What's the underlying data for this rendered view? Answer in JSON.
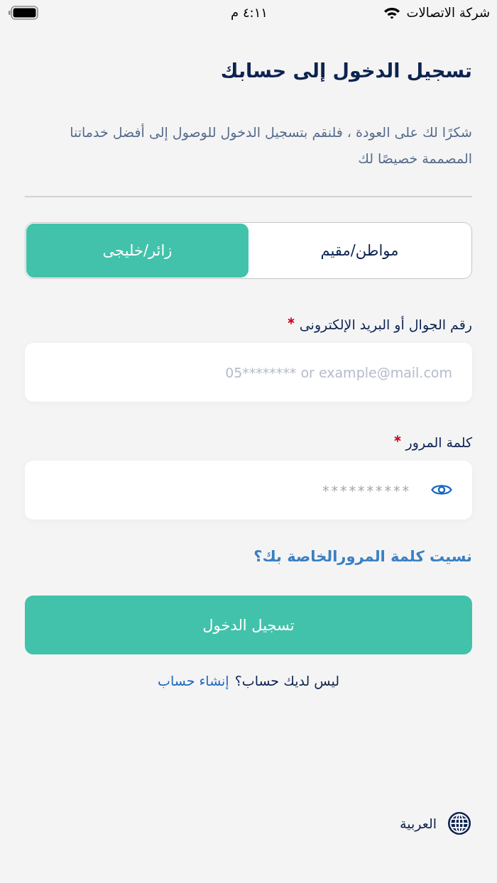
{
  "status_bar": {
    "carrier": "شركة الاتصالات",
    "time": "٤:١١ م"
  },
  "header": {
    "title": "تسجيل الدخول إلى حسابك",
    "subtitle": "شكرًا لك على العودة ، فلنقم بتسجيل الدخول للوصول إلى أفضل خدماتنا المصممة خصيصًا لك"
  },
  "user_type_tabs": [
    {
      "label": "مواطن/مقيم",
      "selected": false
    },
    {
      "label": "زائر/خليجى",
      "selected": true
    }
  ],
  "fields": [
    {
      "kind": "text",
      "label": "رقم الجوال أو البريد الإلكترونى",
      "required": true,
      "placeholder": "05******** or example@mail.com"
    },
    {
      "kind": "password",
      "label": "كلمة المرور",
      "required": true,
      "placeholder": "**********"
    }
  ],
  "forgot_password_link": "نسيت كلمة المرورالخاصة بك؟",
  "submit_button": "تسجيل الدخول",
  "signup": {
    "prompt": "ليس لديك حساب؟",
    "link": "إنشاء حساب"
  },
  "language": {
    "label": "العربية"
  }
}
